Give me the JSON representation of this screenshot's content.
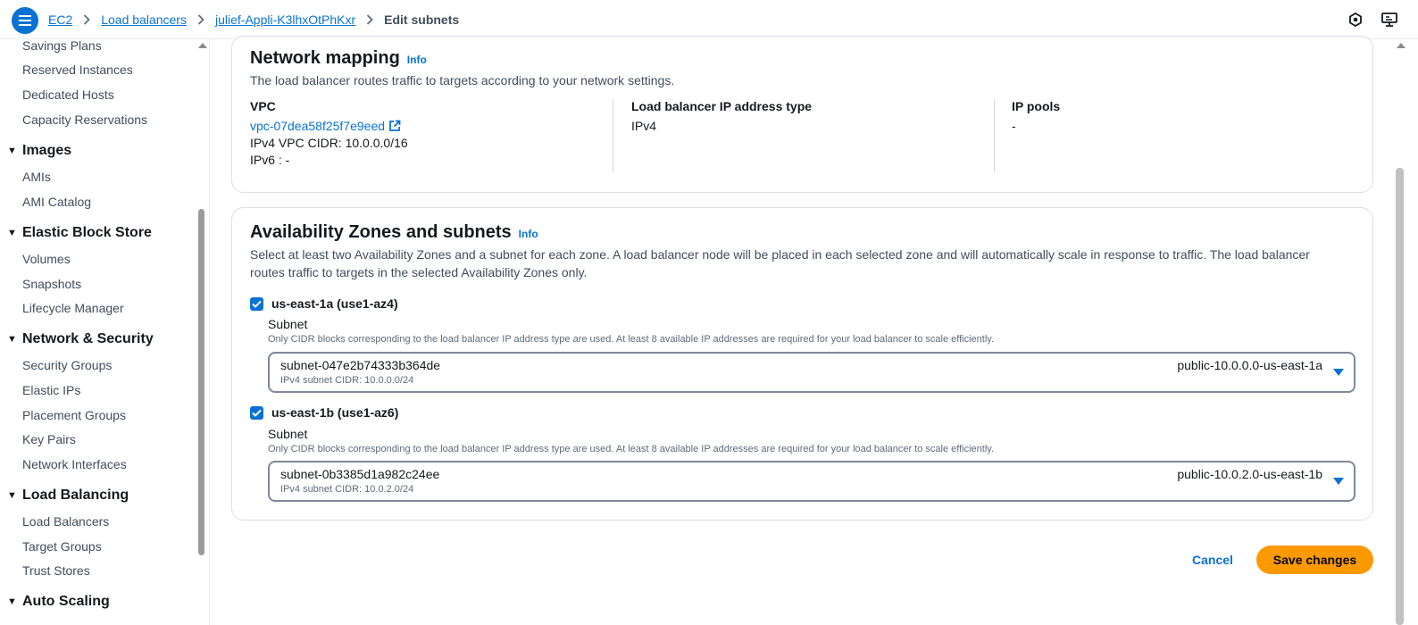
{
  "breadcrumb": {
    "items": [
      "EC2",
      "Load balancers",
      "julief-Appli-K3lhxOtPhKxr"
    ],
    "current": "Edit subnets"
  },
  "top_icons": [
    "settings-hex-icon",
    "feedback-monitor-icon"
  ],
  "sidebar": {
    "links_top": [
      "Savings Plans",
      "Reserved Instances",
      "Dedicated Hosts",
      "Capacity Reservations"
    ],
    "sections": [
      {
        "title": "Images",
        "items": [
          "AMIs",
          "AMI Catalog"
        ]
      },
      {
        "title": "Elastic Block Store",
        "items": [
          "Volumes",
          "Snapshots",
          "Lifecycle Manager"
        ]
      },
      {
        "title": "Network & Security",
        "items": [
          "Security Groups",
          "Elastic IPs",
          "Placement Groups",
          "Key Pairs",
          "Network Interfaces"
        ]
      },
      {
        "title": "Load Balancing",
        "items": [
          "Load Balancers",
          "Target Groups",
          "Trust Stores"
        ]
      },
      {
        "title": "Auto Scaling",
        "items": []
      }
    ]
  },
  "network_mapping": {
    "title": "Network mapping",
    "info": "Info",
    "description": "The load balancer routes traffic to targets according to your network settings.",
    "vpc_label": "VPC",
    "vpc_id": "vpc-07dea58f25f7e9eed",
    "ipv4_cidr": "IPv4 VPC CIDR: 10.0.0.0/16",
    "ipv6": "IPv6 : -",
    "ip_type_label": "Load balancer IP address type",
    "ip_type_value": "IPv4",
    "ip_pools_label": "IP pools",
    "ip_pools_value": "-"
  },
  "availability_zones": {
    "title": "Availability Zones and subnets",
    "info": "Info",
    "description_line1": "Select at least two Availability Zones and a subnet for each zone. A load balancer node will be placed in each selected zone and will automatically scale in response to traffic. The load balancer",
    "description_line2": "routes traffic to targets in the selected Availability Zones only.",
    "zones": [
      {
        "label": "us-east-1a (use1-az4)",
        "checked": true,
        "subnet_label": "Subnet",
        "hint": "Only CIDR blocks corresponding to the load balancer IP address type are used. At least 8 available IP addresses are required for your load balancer to scale efficiently.",
        "subnet_id": "subnet-047e2b74333b364de",
        "subnet_cidr": "IPv4 subnet CIDR: 10.0.0.0/24",
        "subnet_name": "public-10.0.0.0-us-east-1a"
      },
      {
        "label": "us-east-1b (use1-az6)",
        "checked": true,
        "subnet_label": "Subnet",
        "hint": "Only CIDR blocks corresponding to the load balancer IP address type are used. At least 8 available IP addresses are required for your load balancer to scale efficiently.",
        "subnet_id": "subnet-0b3385d1a982c24ee",
        "subnet_cidr": "IPv4 subnet CIDR: 10.0.2.0/24",
        "subnet_name": "public-10.0.2.0-us-east-1b"
      }
    ]
  },
  "actions": {
    "cancel": "Cancel",
    "save": "Save changes"
  },
  "colors": {
    "accent": "#0972d3",
    "primary_button": "#ff9900"
  }
}
